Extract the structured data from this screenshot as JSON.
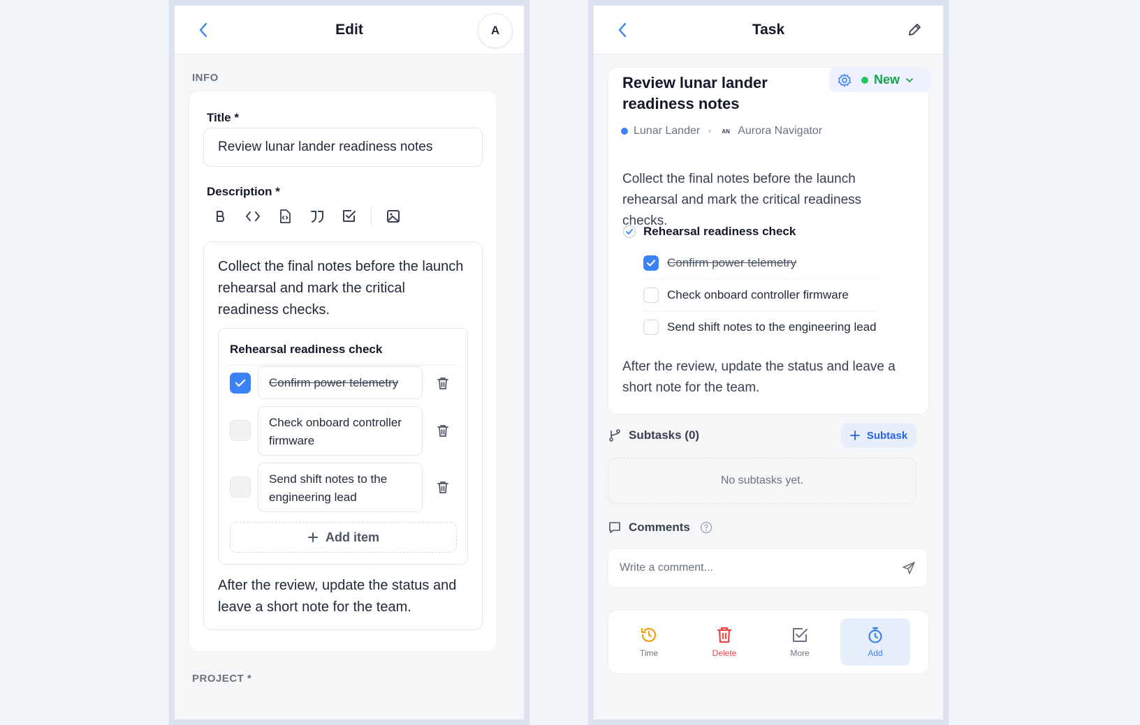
{
  "colors": {
    "accent": "#3b82f6",
    "status_green": "#22c55e",
    "delete_red": "#ef4444",
    "time_orange": "#f59e0b"
  },
  "edit": {
    "title": "Edit",
    "avatar": "A",
    "info_label": "INFO",
    "title_label": "Title *",
    "title_value": "Review lunar lander readiness notes",
    "description_label": "Description *",
    "toolbar_icons": [
      "bold-icon",
      "code-icon",
      "code-file-icon",
      "quote-icon",
      "checklist-icon",
      "image-icon"
    ],
    "desc_intro": "Collect the final notes before the launch rehearsal and mark the critical readiness checks.",
    "checklist_title": "Rehearsal readiness check",
    "items": [
      {
        "text": "Confirm power telemetry",
        "checked": true
      },
      {
        "text": "Check onboard controller firmware",
        "checked": false
      },
      {
        "text": "Send shift notes to the engineering lead",
        "checked": false
      }
    ],
    "add_item": "Add item",
    "desc_outro": "After the review, update the status and leave a short note for the team.",
    "project_label": "PROJECT *"
  },
  "task": {
    "title": "Task",
    "task_title": "Review lunar lander readiness notes",
    "status": "New",
    "project": "Lunar Lander",
    "assignee_initials": "AN",
    "assignee": "Aurora Navigator",
    "desc_intro": "Collect the final notes before the launch rehearsal and mark the critical readiness checks.",
    "checklist_title": "Rehearsal readiness check",
    "items": [
      {
        "text": "Confirm power telemetry",
        "checked": true
      },
      {
        "text": "Check onboard controller firmware",
        "checked": false
      },
      {
        "text": "Send shift notes to the engineering lead",
        "checked": false
      }
    ],
    "desc_outro": "After the review, update the status and leave a short note for the team.",
    "subtasks_label": "Subtasks (0)",
    "add_subtask": "Subtask",
    "no_subtasks": "No subtasks yet.",
    "comments_label": "Comments",
    "comment_placeholder": "Write a comment...",
    "actions": {
      "time": "Time",
      "delete": "Delete",
      "more": "More",
      "add": "Add"
    }
  }
}
